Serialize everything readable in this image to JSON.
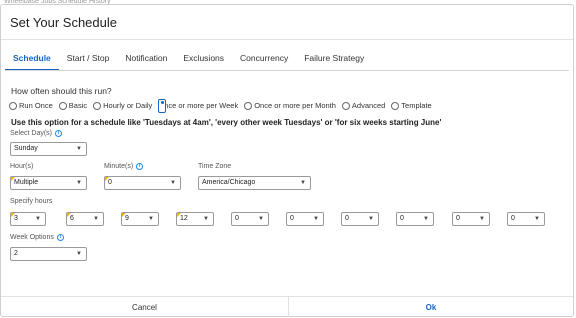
{
  "top_strip": "Wheelbase  Jobs  Schedule  History",
  "dialog": {
    "title": "Set Your Schedule"
  },
  "tabs": [
    {
      "label": "Schedule",
      "active": true
    },
    {
      "label": "Start / Stop"
    },
    {
      "label": "Notification"
    },
    {
      "label": "Exclusions"
    },
    {
      "label": "Concurrency"
    },
    {
      "label": "Failure Strategy"
    }
  ],
  "frequency": {
    "question": "How often should this run?",
    "options": [
      "Run Once",
      "Basic",
      "Hourly or Daily",
      "Once or more per Week",
      "Once or more per Month",
      "Advanced",
      "Template"
    ],
    "selected": "Once or more per Week"
  },
  "hint": "Use this option for a schedule like 'Tuesdays at 4am', 'every other week Tuesdays' or 'for six weeks starting June'",
  "fields": {
    "select_days": {
      "label": "Select Day(s)",
      "value": "Sunday"
    },
    "hours": {
      "label": "Hour(s)",
      "value": "Multiple"
    },
    "minutes": {
      "label": "Minute(s)",
      "value": "0"
    },
    "timezone": {
      "label": "Time Zone",
      "value": "America/Chicago"
    },
    "specify_hours": {
      "label": "Specify hours",
      "values": [
        "3",
        "6",
        "9",
        "12",
        "0",
        "0",
        "0",
        "0",
        "0",
        "0"
      ]
    },
    "week_options": {
      "label": "Week Options",
      "value": "2"
    }
  },
  "footer": {
    "cancel": "Cancel",
    "ok": "Ok"
  },
  "colors": {
    "accent": "#1565c0",
    "flag": "#e6b800"
  },
  "icons": {
    "info": "info-icon",
    "caret": "chevron-down-icon"
  }
}
